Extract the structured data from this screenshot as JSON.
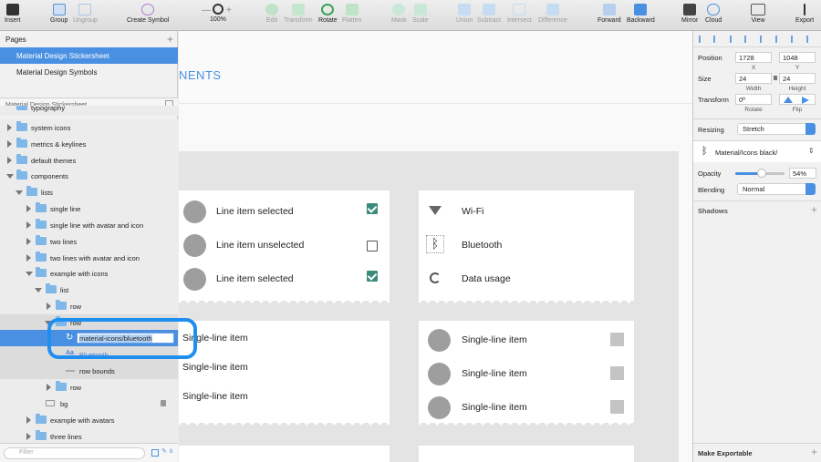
{
  "toolbar": {
    "insert": "Insert",
    "group": "Group",
    "ungroup": "Ungroup",
    "create_symbol": "Create Symbol",
    "zoom": "100%",
    "edit": "Edit",
    "transform": "Transform",
    "rotate": "Rotate",
    "flatten": "Flatten",
    "mask": "Mask",
    "scale": "Scale",
    "union": "Union",
    "subtract": "Subtract",
    "intersect": "Intersect",
    "difference": "Difference",
    "forward": "Forward",
    "backward": "Backward",
    "mirror": "Mirror",
    "cloud": "Cloud",
    "view": "View",
    "export": "Export",
    "zoom_minus": "—",
    "zoom_plus": "+"
  },
  "pages": {
    "header": "Pages",
    "items": [
      "Material Design Stickersheet",
      "Material Design Symbols"
    ]
  },
  "layers": {
    "header": "Material Design Stickersheet",
    "items": [
      "typography",
      "system icons",
      "metrics & keylines",
      "default themes",
      "components",
      "lists",
      "single line",
      "single line with avatar and icon",
      "two lines",
      "two lines with avatar and icon",
      "example with icons",
      "list",
      "row",
      "row",
      "material-icons/bluetooth",
      "Bluetooth",
      "row bounds",
      "row",
      "bg",
      "example with avatars",
      "three lines"
    ],
    "filter_placeholder": "Filter",
    "filter_count": "8"
  },
  "canvas": {
    "title_partial": "NENTS",
    "card1": [
      "Line item selected",
      "Line item unselected",
      "Line item selected"
    ],
    "card2": [
      "Wi-Fi",
      "Bluetooth",
      "Data usage"
    ],
    "card3": [
      "Single-line item",
      "Single-line item",
      "Single-line item"
    ],
    "card4": [
      "Single-line item",
      "Single-line item",
      "Single-line item"
    ]
  },
  "inspector": {
    "position_label": "Position",
    "x": "1728",
    "y": "1048",
    "x_sub": "X",
    "y_sub": "Y",
    "size_label": "Size",
    "width": "24",
    "height": "24",
    "width_sub": "Width",
    "height_sub": "Height",
    "transform_label": "Transform",
    "rotate": "0º",
    "rotate_sub": "Rotate",
    "flip_sub": "Flip",
    "resizing_label": "Resizing",
    "resizing_value": "Stretch",
    "symbol_name": "Material/Icons black/",
    "opacity_label": "Opacity",
    "opacity_value": "54%",
    "opacity": 0.54,
    "blending_label": "Blending",
    "blending_value": "Normal",
    "shadows_label": "Shadows",
    "make_exportable": "Make Exportable"
  },
  "colors": {
    "accent": "#4a90e2",
    "checkbox": "#3b8b7d",
    "highlight": "#1e8ff0"
  }
}
